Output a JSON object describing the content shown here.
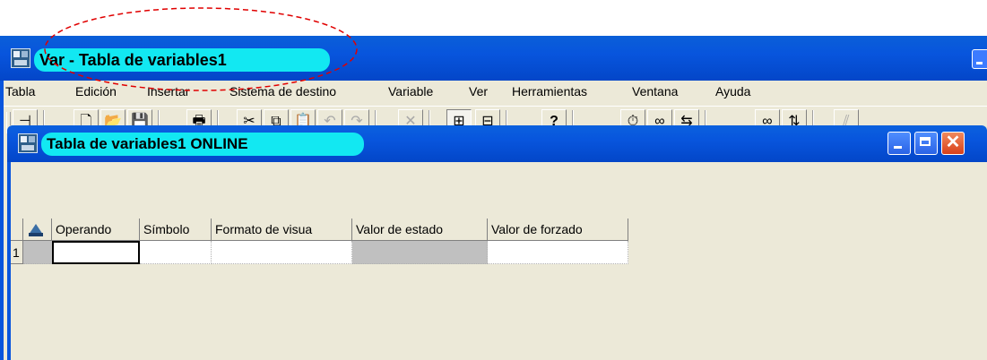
{
  "outer_window": {
    "title": "Var - Tabla de variables1"
  },
  "menu": [
    "Tabla",
    "Edición",
    "Insertar",
    "Sistema de destino",
    "Variable",
    "Ver",
    "Herramientas",
    "Ventana",
    "Ayuda"
  ],
  "toolbar": {
    "buttons": [
      {
        "name": "pin-icon",
        "glyph": "⊣"
      },
      {
        "name": "new-document-icon",
        "glyph": "🗋"
      },
      {
        "name": "open-folder-icon",
        "glyph": "📂"
      },
      {
        "name": "save-icon",
        "glyph": "💾"
      },
      {
        "name": "print-icon",
        "glyph": "🖶"
      },
      {
        "name": "cut-icon",
        "glyph": "✂"
      },
      {
        "name": "copy-icon",
        "glyph": "⧉"
      },
      {
        "name": "paste-icon",
        "glyph": "📋"
      },
      {
        "name": "undo-icon",
        "glyph": "↶"
      },
      {
        "name": "redo-icon",
        "glyph": "↷"
      },
      {
        "name": "delete-icon",
        "glyph": "✕"
      },
      {
        "name": "online-icon",
        "glyph": "⊞"
      },
      {
        "name": "accessible-nodes-icon",
        "glyph": "⊟"
      },
      {
        "name": "context-help-icon",
        "glyph": "?"
      },
      {
        "name": "monitor-variable-icon",
        "glyph": "⏱"
      },
      {
        "name": "monitor-glasses-icon",
        "glyph": "∞"
      },
      {
        "name": "modify-variable-icon",
        "glyph": "⇆"
      },
      {
        "name": "monitor-immediate-icon",
        "glyph": "∞"
      },
      {
        "name": "modify-immediate-icon",
        "glyph": "⇅"
      },
      {
        "name": "force-icon",
        "glyph": "⫽"
      }
    ]
  },
  "inner_window": {
    "title": "Tabla de variables1  ONLINE"
  },
  "table": {
    "columns": [
      "Operando",
      "Símbolo",
      "Formato de visua",
      "Valor de estado",
      "Valor de forzado"
    ],
    "rows": [
      {
        "number": "1",
        "cells": [
          "",
          "",
          "",
          "",
          ""
        ]
      }
    ]
  },
  "colors": {
    "title_bar": "#0855dd",
    "title_highlight": "#12e8f2",
    "annotation": "#e00000",
    "face": "#ece9d8"
  }
}
